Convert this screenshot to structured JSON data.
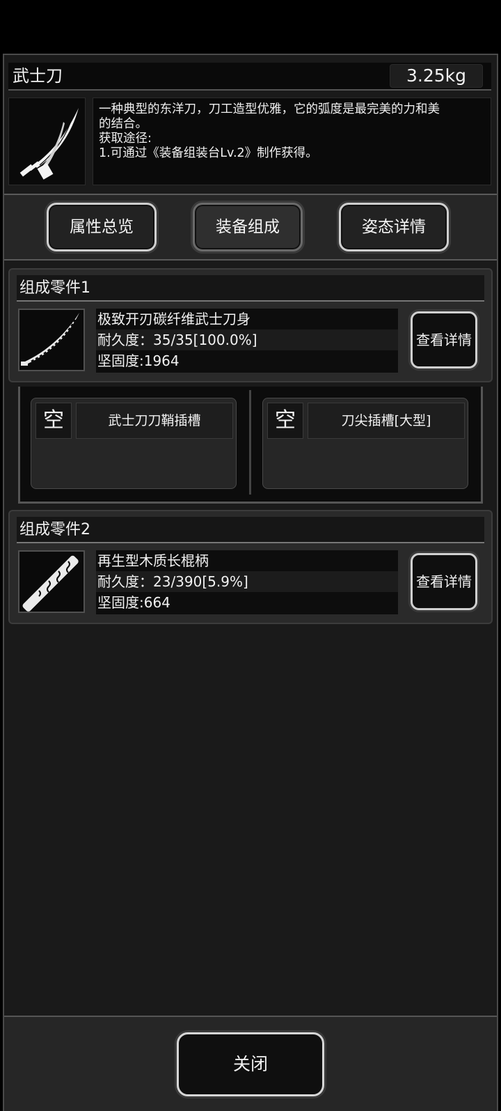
{
  "item": {
    "name": "武士刀",
    "weight": "3.25kg",
    "icon": "katana-icon",
    "description": [
      "一种典型的东洋刀，刀工造型优雅，它的弧度是最完美的力和美",
      "的结合。",
      "获取途径:",
      "1.可通过《装备组装台Lv.2》制作获得。"
    ]
  },
  "tabs": [
    {
      "label": "属性总览",
      "active": false
    },
    {
      "label": "装备组成",
      "active": true
    },
    {
      "label": "姿态详情",
      "active": false
    }
  ],
  "parts": [
    {
      "title": "组成零件1",
      "icon": "blade-icon",
      "name": "极致开刃碳纤维武士刀身",
      "durability": "耐久度：35/35[100.0%]",
      "hardness": "坚固度:1964",
      "button": "查看详情"
    },
    {
      "title": "组成零件2",
      "icon": "wooden-hilt-icon",
      "name": "再生型木质长棍柄",
      "durability": "耐久度：23/390[5.9%]",
      "hardness": "坚固度:664",
      "button": "查看详情"
    }
  ],
  "slots": [
    {
      "status": "空",
      "label": "武士刀刀鞘插槽"
    },
    {
      "status": "空",
      "label": "刀尖插槽[大型]"
    }
  ],
  "close_label": "关闭",
  "colors": {
    "panel_bg": "#1a1a1a",
    "border": "#d0d0d0",
    "text": "#f2f2f2"
  }
}
